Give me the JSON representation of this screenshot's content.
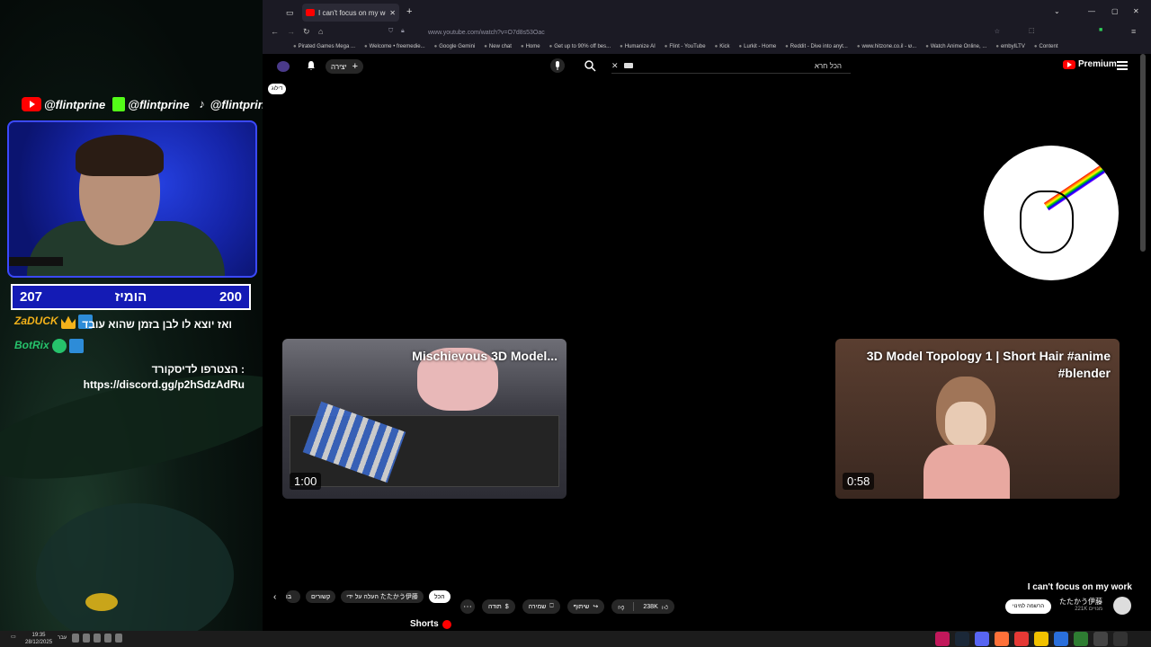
{
  "overlay": {
    "socials": [
      {
        "platform_icon": "youtube-icon",
        "handle": "@flintprine"
      },
      {
        "platform_icon": "kick-icon",
        "handle": "@flintprine"
      },
      {
        "platform_icon": "tiktok-icon",
        "handle": "@flintprine"
      }
    ],
    "score": {
      "left": "207",
      "label": "הומיז",
      "right": "200"
    },
    "chat": [
      {
        "user": "ZaDUCK",
        "message": "ואז יוצא לו לבן בזמן שהוא עובד"
      },
      {
        "user": "BotRix",
        "message": "הצטרפו לדיסקורד :"
      }
    ],
    "discord_link": "https://discord.gg/p2hSdzAdRu"
  },
  "browser": {
    "tab_title": "I can't focus on my work - YouTube",
    "url": "www.youtube.com/watch?v=O7d8s53Oac",
    "bookmarks": [
      "Pirated Games Mega ...",
      "Welcome • freemedie...",
      "Google Gemini",
      "New chat",
      "Home",
      "Get up to 90% off bes...",
      "Humanize AI",
      "Flint - YouTube",
      "Kick",
      "Lurkit - Home",
      "Reddit - Dive into anyt...",
      "www.hitzone.co.il - ש...",
      "Watch Anime Online, ...",
      "embyILTV",
      "Content"
    ]
  },
  "youtube": {
    "create_label": "יצירה",
    "search_value": "הכל חרא",
    "premium_label": "Premium",
    "skip_label": "דילוג",
    "cards": [
      {
        "title": "Mischievous 3D Model...",
        "duration": "1:00"
      },
      {
        "title": "3D Model Topology 1 | Short Hair #anime #blender",
        "duration": "0:58"
      }
    ],
    "video_title": "I can't focus on my work",
    "chips": [
      "הכל",
      "העלה על ידי たたかう伊藤",
      "קשורים",
      "בו"
    ],
    "actions": {
      "likes": "238K",
      "share": "שיתוף",
      "save": "שמירה",
      "thanks": "תודה"
    },
    "subscribe_label": "הרשמה למינוי",
    "channel_name": "たたかう伊藤",
    "subscribers": "221K מנויים",
    "shorts_label": "Shorts"
  },
  "taskbar": {
    "time": "19:35",
    "date": "28/12/2025",
    "language": "עבר"
  }
}
